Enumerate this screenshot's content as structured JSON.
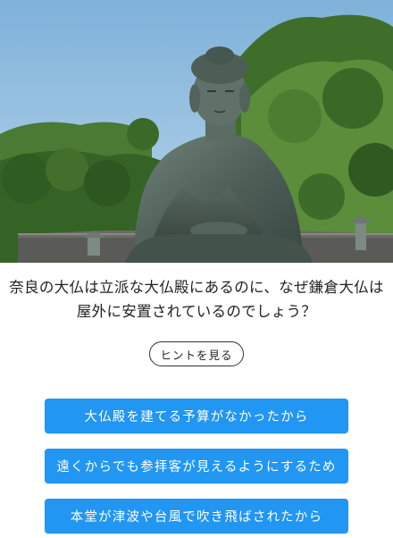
{
  "photo": {
    "subject": "Great Buddha statue (daibutsu) outdoors"
  },
  "question": {
    "line1": "奈良の大仏は立派な大仏殿にあるのに、なぜ鎌倉大仏は",
    "line2": "屋外に安置されているのでしょう？"
  },
  "hint": {
    "label": "ヒントを見る"
  },
  "answers": [
    {
      "label": "大仏殿を建てる予算がなかったから"
    },
    {
      "label": "遠くからでも参拝客が見えるようにするため"
    },
    {
      "label": "本堂が津波や台風で吹き飛ばされたから"
    }
  ],
  "colors": {
    "accent": "#2196f3",
    "text": "#222222"
  }
}
